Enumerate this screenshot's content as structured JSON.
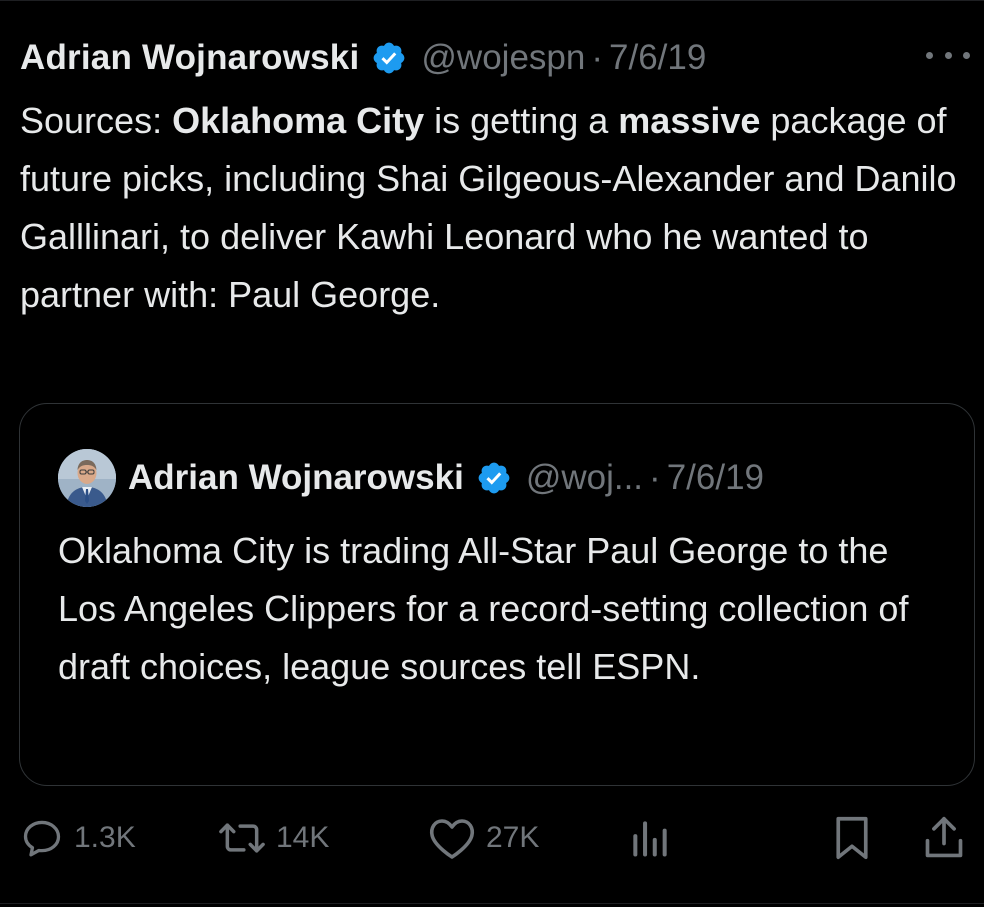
{
  "tweet": {
    "author_name": "Adrian Wojnarowski",
    "handle": "@wojespn",
    "separator": "·",
    "date": "7/6/19",
    "body_segments": [
      {
        "text": "Sources: ",
        "bold": false
      },
      {
        "text": "Oklahoma City",
        "bold": true
      },
      {
        "text": " is getting a ",
        "bold": false
      },
      {
        "text": "massive",
        "bold": true
      },
      {
        "text": " package of future picks, including Shai Gilgeous-Alexander and Danilo Galllinari, to deliver Kawhi Leonard who he wanted to partner with: Paul George.",
        "bold": false
      }
    ]
  },
  "quoted_tweet": {
    "author_name": "Adrian Wojnarowski",
    "handle": "@woj...",
    "separator": "·",
    "date": "7/6/19",
    "body": "Oklahoma City is trading All-Star Paul George to the Los Angeles Clippers for a record-setting collection of draft choices, league sources tell ESPN."
  },
  "actions": {
    "reply_count": "1.3K",
    "retweet_count": "14K",
    "like_count": "27K"
  },
  "icons": {
    "verified": "verified-badge-icon",
    "more": "more-options-icon",
    "reply": "reply-icon",
    "retweet": "retweet-icon",
    "like": "heart-icon",
    "views": "analytics-icon",
    "bookmark": "bookmark-icon",
    "share": "share-icon"
  },
  "colors": {
    "background": "#000000",
    "text_primary": "#e7e9ea",
    "text_secondary": "#71767b",
    "verified_blue": "#1d9bf0",
    "border": "#2f3336"
  }
}
